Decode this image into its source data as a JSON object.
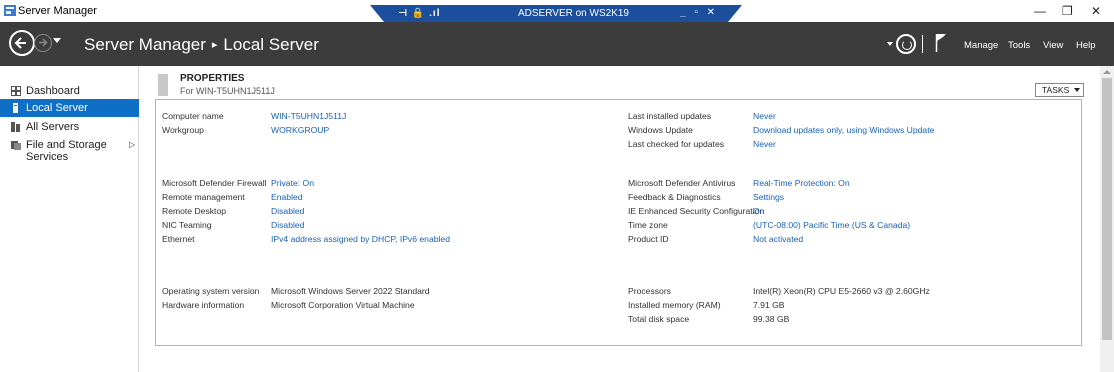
{
  "window": {
    "title": "Server Manager",
    "controls": {
      "minimize": "—",
      "restore": "❐",
      "close": "✕"
    }
  },
  "rdp": {
    "left_icons": "⊣ 🔒 .ıl",
    "title": "ADSERVER on WS2K19",
    "right_controls": "_ ▫ ✕",
    "color": "#1b4f9c"
  },
  "header": {
    "app": "Server Manager",
    "page": "Local Server",
    "separator": "▸",
    "menu": [
      "Manage",
      "Tools",
      "View",
      "Help"
    ]
  },
  "sidebar": {
    "items": [
      {
        "label": "Dashboard",
        "icon": "dashboard-icon",
        "active": false
      },
      {
        "label": "Local Server",
        "icon": "server-icon",
        "active": true
      },
      {
        "label": "All Servers",
        "icon": "servers-icon",
        "active": false
      },
      {
        "label": "File and Storage Services",
        "icon": "storage-icon",
        "active": false,
        "expand": "▷"
      }
    ]
  },
  "properties": {
    "title": "PROPERTIES",
    "subtitle": "For WIN-T5UHN1J511J",
    "tasks": "TASKS",
    "left_group1": [
      {
        "key": "Computer name",
        "value": "WIN-T5UHN1J511J",
        "link": true
      },
      {
        "key": "Workgroup",
        "value": "WORKGROUP",
        "link": true
      }
    ],
    "left_group2": [
      {
        "key": "Microsoft Defender Firewall",
        "value": "Private: On",
        "link": true
      },
      {
        "key": "Remote management",
        "value": "Enabled",
        "link": true
      },
      {
        "key": "Remote Desktop",
        "value": "Disabled",
        "link": true
      },
      {
        "key": "NIC Teaming",
        "value": "Disabled",
        "link": true
      },
      {
        "key": "Ethernet",
        "value": "IPv4 address assigned by DHCP, IPv6 enabled",
        "link": true
      }
    ],
    "left_group3": [
      {
        "key": "Operating system version",
        "value": "Microsoft Windows Server 2022 Standard",
        "link": false
      },
      {
        "key": "Hardware information",
        "value": "Microsoft Corporation Virtual Machine",
        "link": false
      }
    ],
    "right_group1": [
      {
        "key": "Last installed updates",
        "value": "Never",
        "link": true
      },
      {
        "key": "Windows Update",
        "value": "Download updates only, using Windows Update",
        "link": true
      },
      {
        "key": "Last checked for updates",
        "value": "Never",
        "link": true
      }
    ],
    "right_group2": [
      {
        "key": "Microsoft Defender Antivirus",
        "value": "Real-Time Protection: On",
        "link": true
      },
      {
        "key": "Feedback & Diagnostics",
        "value": "Settings",
        "link": true
      },
      {
        "key": "IE Enhanced Security Configuration",
        "value": "On",
        "link": true
      },
      {
        "key": "Time zone",
        "value": "(UTC-08:00) Pacific Time (US & Canada)",
        "link": true
      },
      {
        "key": "Product ID",
        "value": "Not activated",
        "link": true
      }
    ],
    "right_group3": [
      {
        "key": "Processors",
        "value": "Intel(R) Xeon(R) CPU E5-2660 v3 @ 2.60GHz",
        "link": false
      },
      {
        "key": "Installed memory (RAM)",
        "value": "7.91 GB",
        "link": false
      },
      {
        "key": "Total disk space",
        "value": "99.38 GB",
        "link": false
      }
    ]
  },
  "colors": {
    "header_bg": "#3c3c3c",
    "accent": "#0f6fc6",
    "link": "#1a62b8"
  }
}
